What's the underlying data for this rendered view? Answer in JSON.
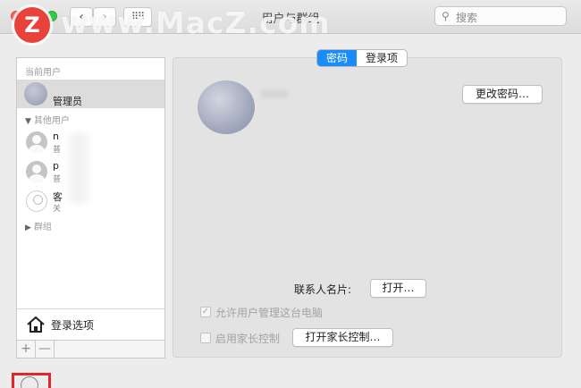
{
  "window": {
    "title": "用户与群组",
    "search_placeholder": "搜索"
  },
  "watermark": {
    "logo_letter": "Z",
    "text": "www.MacZ.com"
  },
  "sidebar": {
    "current_users_header": "当前用户",
    "current_user_role": "管理员",
    "other_users_header": "其他用户",
    "other_users": [
      {
        "name": "n",
        "sub": "普"
      },
      {
        "name": "p",
        "sub": "普"
      },
      {
        "name": "客",
        "sub": "关"
      }
    ],
    "groups_label": "群组",
    "login_options_label": "登录选项",
    "add_symbol": "+",
    "remove_symbol": "—"
  },
  "tabs": [
    {
      "label": "密码",
      "active": true
    },
    {
      "label": "登录项",
      "active": false
    }
  ],
  "main": {
    "change_password_button": "更改密码…",
    "contact_card_label": "联系人名片:",
    "open_button": "打开…",
    "allow_admin_label": "允许用户管理这台电脑",
    "allow_admin_checked": true,
    "parental_controls_label": "启用家长控制",
    "parental_controls_checked": false,
    "open_parental_button": "打开家长控制…"
  },
  "colors": {
    "accent": "#1a8cf7",
    "highlight_box": "#e0262b",
    "watermark_logo": "#e8433a"
  }
}
